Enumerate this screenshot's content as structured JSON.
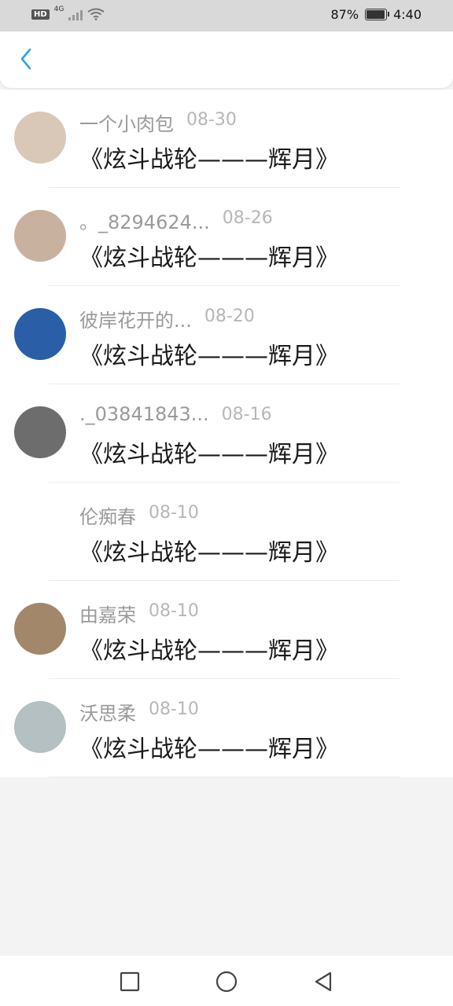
{
  "status_bar": {
    "hd": "HD",
    "network": "4G",
    "battery_text": "87%",
    "battery_level": 0.87,
    "time": "4:40"
  },
  "header": {
    "back_icon": "chevron-left-icon",
    "accent": "#2fa3e6"
  },
  "items": [
    {
      "name": "一个小肉包",
      "date": "08-30",
      "message": "《炫斗战轮———辉月》",
      "avatar": "#d9c7b8"
    },
    {
      "name": "。_8294624...",
      "date": "08-26",
      "message": "《炫斗战轮———辉月》",
      "avatar": "#c9b1a0"
    },
    {
      "name": "彼岸花开的...",
      "date": "08-20",
      "message": "《炫斗战轮———辉月》",
      "avatar": "#2a5fa8"
    },
    {
      "name": "._03841843...",
      "date": "08-16",
      "message": "《炫斗战轮———辉月》",
      "avatar": "#6d6d6d"
    },
    {
      "name": "伦痴春",
      "date": "08-10",
      "message": "《炫斗战轮———辉月》",
      "avatar": "#ffffff"
    },
    {
      "name": "由嘉荣",
      "date": "08-10",
      "message": "《炫斗战轮———辉月》",
      "avatar": "#a3876b"
    },
    {
      "name": "沃思柔",
      "date": "08-10",
      "message": "《炫斗战轮———辉月》",
      "avatar": "#b5c0c2"
    }
  ],
  "nav": {
    "recents_icon": "square-icon",
    "home_icon": "circle-icon",
    "back_icon": "triangle-back-icon"
  }
}
